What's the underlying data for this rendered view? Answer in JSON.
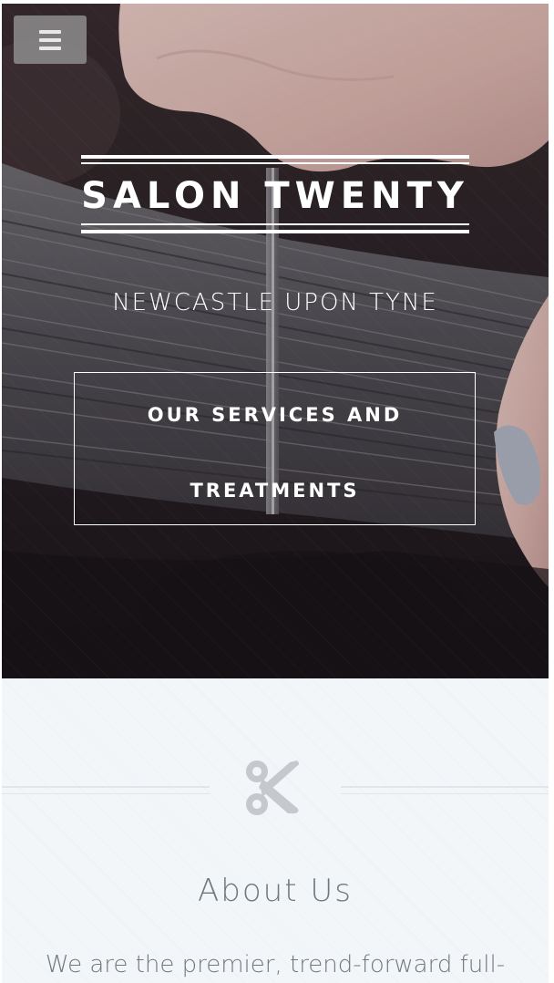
{
  "header": {
    "menu_icon": "hamburger-menu-icon"
  },
  "hero": {
    "title": "SALON TWENTY",
    "tagline": "NEWCASTLE UPON TYNE",
    "cta_line1": "OUR SERVICES AND",
    "cta_line2": "TREATMENTS",
    "background": "photo of hairdresser cutting dark hair"
  },
  "about": {
    "icon": "scissors-icon",
    "title": "About Us",
    "intro_partial": "We are the premier, trend-forward full-"
  },
  "colors": {
    "overlay_text": "#ffffff",
    "section_bg": "#f3f6f9",
    "heading_gray": "#6f7780",
    "icon_gray": "#c5c9cd"
  }
}
